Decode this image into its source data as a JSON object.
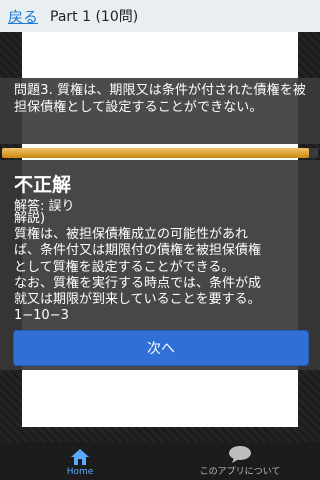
{
  "topbar": {
    "back_label": "戻る",
    "part_title": "Part 1 (10問)"
  },
  "question": {
    "text": "問題3. 質権は、期限又は条件が付された債権を被担保債権として設定することができない。"
  },
  "progress": {
    "value": 0.97
  },
  "answer": {
    "result": "不正解",
    "answer_line": "解答: 誤り",
    "explanation_lines": [
      "解説)",
      "質権は、被担保債権成立の可能性があれ",
      "ば、条件付又は期限付の債権を被担保債権",
      "として質権を設定することができる。",
      "なお、質権を実行する時点では、条件が成",
      "就又は期限が到来していることを要する。",
      "1−10−3"
    ]
  },
  "next_button": {
    "label": "次へ"
  },
  "bottom_nav": {
    "home_label": "Home",
    "about_label": "このアプリについて",
    "home_icon": "home-icon",
    "about_icon": "chat-bubble-icon",
    "active_color": "#5aa9ff"
  }
}
